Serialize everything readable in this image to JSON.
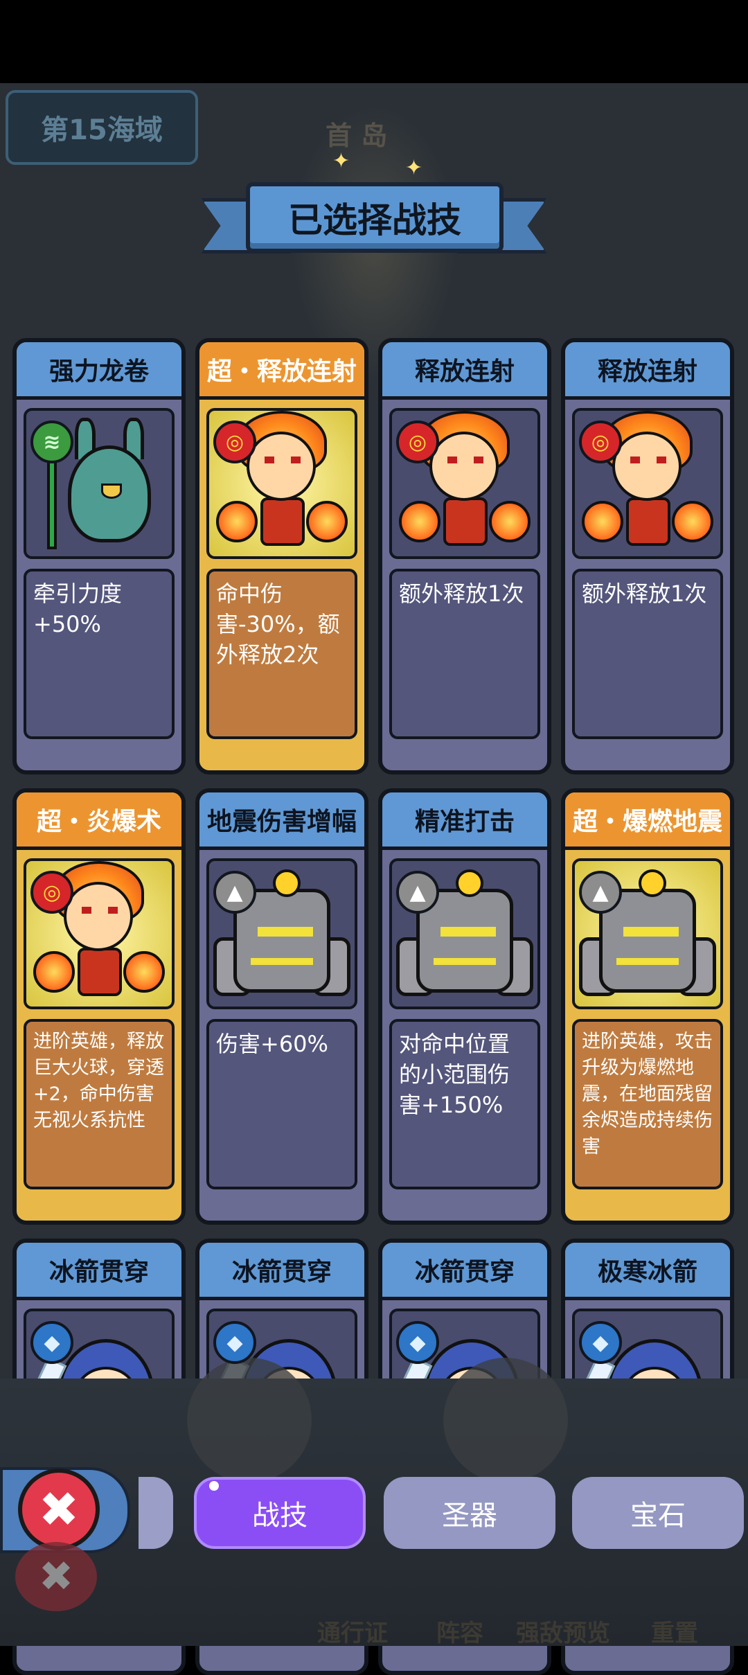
{
  "header": {
    "sea_zone": "第15海域",
    "island_label": "首 岛",
    "title": "已选择战技"
  },
  "cards": [
    {
      "name": "强力龙卷",
      "style": "blue",
      "element_icon": "wind-icon",
      "hero": "bird",
      "desc": "牵引力度+50%"
    },
    {
      "name": "超・释放连射",
      "style": "orange",
      "element_icon": "fire-icon",
      "hero": "fire",
      "desc": "命中伤害-30%，额外释放2次"
    },
    {
      "name": "释放连射",
      "style": "blue",
      "element_icon": "fire-icon",
      "hero": "fire",
      "desc": "额外释放1次"
    },
    {
      "name": "释放连射",
      "style": "blue",
      "element_icon": "fire-icon",
      "hero": "fire",
      "desc": "额外释放1次"
    },
    {
      "name": "超・炎爆术",
      "style": "orange",
      "element_icon": "fire-icon",
      "hero": "fire",
      "desc": "进阶英雄，释放巨大火球，穿透+2，命中伤害无视火系抗性"
    },
    {
      "name": "地震伤害增幅",
      "style": "blue",
      "element_icon": "rock-icon",
      "hero": "rock",
      "desc": "伤害+60%"
    },
    {
      "name": "精准打击",
      "style": "blue",
      "element_icon": "rock-icon",
      "hero": "rock",
      "desc": "对命中位置的小范围伤害+150%"
    },
    {
      "name": "超・爆燃地震",
      "style": "orange",
      "element_icon": "rock-icon",
      "hero": "rock",
      "desc": "进阶英雄，攻击升级为爆燃地震，在地面残留余烬造成持续伤害"
    },
    {
      "name": "冰箭贯穿",
      "style": "blue",
      "element_icon": "ice-icon",
      "hero": "ice",
      "desc": ""
    },
    {
      "name": "冰箭贯穿",
      "style": "blue",
      "element_icon": "ice-icon",
      "hero": "ice",
      "desc": ""
    },
    {
      "name": "冰箭贯穿",
      "style": "blue",
      "element_icon": "ice-icon",
      "hero": "ice",
      "desc": ""
    },
    {
      "name": "极寒冰箭",
      "style": "blue",
      "element_icon": "ice-icon",
      "hero": "ice",
      "desc": ""
    }
  ],
  "tabs": [
    {
      "label": "战技",
      "active": true
    },
    {
      "label": "圣器",
      "active": false
    },
    {
      "label": "宝石",
      "active": false
    }
  ],
  "bottom_nav": [
    "通行证",
    "阵容",
    "强敌预览",
    "重置"
  ],
  "colors": {
    "active_tab": "#8b4ef5",
    "inactive_tab": "#9598c2",
    "card_blue_header": "#5f98d4",
    "card_orange_header": "#ec9530",
    "close_button": "#e23a4c"
  }
}
